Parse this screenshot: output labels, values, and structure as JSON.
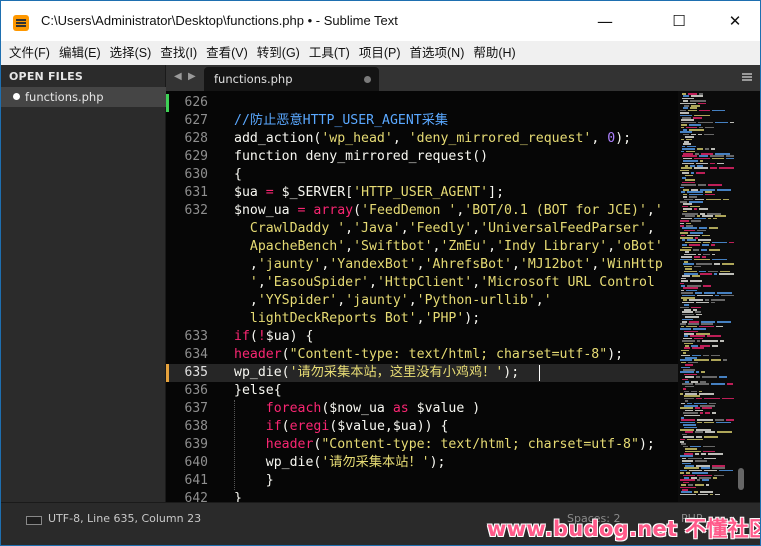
{
  "window": {
    "title": "C:\\Users\\Administrator\\Desktop\\functions.php • - Sublime Text",
    "minimize": "—",
    "maximize": "☐",
    "close": "✕"
  },
  "menu": [
    "文件(F)",
    "编辑(E)",
    "选择(S)",
    "查找(I)",
    "查看(V)",
    "转到(G)",
    "工具(T)",
    "项目(P)",
    "首选项(N)",
    "帮助(H)"
  ],
  "sidebar": {
    "header": "OPEN FILES",
    "files": [
      "functions.php"
    ]
  },
  "tabs": {
    "prev": "◀",
    "next": "▶",
    "active": "functions.php"
  },
  "gutter": [
    "626",
    "627",
    "628",
    "629",
    "630",
    "631",
    "632",
    "",
    "",
    "",
    "",
    "",
    "",
    "633",
    "634",
    "635",
    "636",
    "637",
    "638",
    "639",
    "640",
    "641",
    "642"
  ],
  "code": [
    [],
    [
      {
        "t": "//防止恶意HTTP_USER_AGENT采集",
        "c": "comment"
      }
    ],
    [
      {
        "t": "add_action",
        "c": "plain"
      },
      {
        "t": "(",
        "c": "plain"
      },
      {
        "t": "'wp_head'",
        "c": "str"
      },
      {
        "t": ", ",
        "c": "plain"
      },
      {
        "t": "'deny_mirrored_request'",
        "c": "str"
      },
      {
        "t": ", ",
        "c": "plain"
      },
      {
        "t": "0",
        "c": "num"
      },
      {
        "t": ");",
        "c": "plain"
      }
    ],
    [
      {
        "t": "function",
        "c": "plain"
      },
      {
        "t": " deny_mirrored_request()",
        "c": "plain"
      }
    ],
    [
      {
        "t": "{",
        "c": "plain"
      }
    ],
    [
      {
        "t": "$ua",
        "c": "plain"
      },
      {
        "t": " = ",
        "c": "op"
      },
      {
        "t": "$_SERVER",
        "c": "plain"
      },
      {
        "t": "[",
        "c": "plain"
      },
      {
        "t": "'HTTP_USER_AGENT'",
        "c": "str"
      },
      {
        "t": "];",
        "c": "plain"
      }
    ],
    [
      {
        "t": "$now_ua",
        "c": "plain"
      },
      {
        "t": " = ",
        "c": "op"
      },
      {
        "t": "array",
        "c": "kw"
      },
      {
        "t": "(",
        "c": "plain"
      },
      {
        "t": "'FeedDemon '",
        "c": "str"
      },
      {
        "t": ",",
        "c": "plain"
      },
      {
        "t": "'BOT/0.1 (BOT for JCE)'",
        "c": "str"
      },
      {
        "t": ",",
        "c": "plain"
      },
      {
        "t": "'",
        "c": "str"
      }
    ],
    [
      {
        "t": "  CrawlDaddy '",
        "c": "str"
      },
      {
        "t": ",",
        "c": "plain"
      },
      {
        "t": "'Java'",
        "c": "str"
      },
      {
        "t": ",",
        "c": "plain"
      },
      {
        "t": "'Feedly'",
        "c": "str"
      },
      {
        "t": ",",
        "c": "plain"
      },
      {
        "t": "'UniversalFeedParser'",
        "c": "str"
      },
      {
        "t": ",",
        "c": "plain"
      }
    ],
    [
      {
        "t": "  ApacheBench'",
        "c": "str"
      },
      {
        "t": ",",
        "c": "plain"
      },
      {
        "t": "'Swiftbot'",
        "c": "str"
      },
      {
        "t": ",",
        "c": "plain"
      },
      {
        "t": "'ZmEu'",
        "c": "str"
      },
      {
        "t": ",",
        "c": "plain"
      },
      {
        "t": "'Indy Library'",
        "c": "str"
      },
      {
        "t": ",",
        "c": "plain"
      },
      {
        "t": "'oBot'",
        "c": "str"
      }
    ],
    [
      {
        "t": "  ,",
        "c": "plain"
      },
      {
        "t": "'jaunty'",
        "c": "str"
      },
      {
        "t": ",",
        "c": "plain"
      },
      {
        "t": "'YandexBot'",
        "c": "str"
      },
      {
        "t": ",",
        "c": "plain"
      },
      {
        "t": "'AhrefsBot'",
        "c": "str"
      },
      {
        "t": ",",
        "c": "plain"
      },
      {
        "t": "'MJ12bot'",
        "c": "str"
      },
      {
        "t": ",",
        "c": "plain"
      },
      {
        "t": "'WinHttp",
        "c": "str"
      }
    ],
    [
      {
        "t": "  '",
        "c": "str"
      },
      {
        "t": ",",
        "c": "plain"
      },
      {
        "t": "'EasouSpider'",
        "c": "str"
      },
      {
        "t": ",",
        "c": "plain"
      },
      {
        "t": "'HttpClient'",
        "c": "str"
      },
      {
        "t": ",",
        "c": "plain"
      },
      {
        "t": "'Microsoft URL Control",
        "c": "str"
      }
    ],
    [
      {
        "t": "  ,",
        "c": "plain"
      },
      {
        "t": "'YYSpider'",
        "c": "str"
      },
      {
        "t": ",",
        "c": "plain"
      },
      {
        "t": "'jaunty'",
        "c": "str"
      },
      {
        "t": ",",
        "c": "plain"
      },
      {
        "t": "'Python-urllib'",
        "c": "str"
      },
      {
        "t": ",",
        "c": "plain"
      },
      {
        "t": "'",
        "c": "str"
      }
    ],
    [
      {
        "t": "  lightDeckReports Bot'",
        "c": "str"
      },
      {
        "t": ",",
        "c": "plain"
      },
      {
        "t": "'PHP'",
        "c": "str"
      },
      {
        "t": ");",
        "c": "plain"
      }
    ],
    [
      {
        "t": "if",
        "c": "kw"
      },
      {
        "t": "(",
        "c": "plain"
      },
      {
        "t": "!",
        "c": "op"
      },
      {
        "t": "$ua",
        "c": "plain"
      },
      {
        "t": ") {",
        "c": "plain"
      }
    ],
    [
      {
        "t": "header",
        "c": "kw"
      },
      {
        "t": "(",
        "c": "plain"
      },
      {
        "t": "\"Content-type: text/html; charset=utf-8\"",
        "c": "str"
      },
      {
        "t": ");",
        "c": "plain"
      }
    ],
    [
      {
        "t": "wp_die",
        "c": "plain"
      },
      {
        "t": "(",
        "c": "plain"
      },
      {
        "t": "'请勿采集本站，这里没有小鸡鸡！'",
        "c": "str"
      },
      {
        "t": ");",
        "c": "plain"
      }
    ],
    [
      {
        "t": "}else{",
        "c": "plain"
      }
    ],
    [
      {
        "t": "    ",
        "c": "plain"
      },
      {
        "t": "foreach",
        "c": "kw"
      },
      {
        "t": "(",
        "c": "plain"
      },
      {
        "t": "$now_ua",
        "c": "plain"
      },
      {
        "t": " as ",
        "c": "kw"
      },
      {
        "t": "$value",
        "c": "plain"
      },
      {
        "t": " )",
        "c": "plain"
      }
    ],
    [
      {
        "t": "    ",
        "c": "plain"
      },
      {
        "t": "if",
        "c": "kw"
      },
      {
        "t": "(",
        "c": "plain"
      },
      {
        "t": "eregi",
        "c": "kw"
      },
      {
        "t": "(",
        "c": "plain"
      },
      {
        "t": "$value",
        "c": "plain"
      },
      {
        "t": ",",
        "c": "plain"
      },
      {
        "t": "$ua",
        "c": "plain"
      },
      {
        "t": ")) {",
        "c": "plain"
      }
    ],
    [
      {
        "t": "    ",
        "c": "plain"
      },
      {
        "t": "header",
        "c": "kw"
      },
      {
        "t": "(",
        "c": "plain"
      },
      {
        "t": "\"Content-type: text/html; charset=utf-8\"",
        "c": "str"
      },
      {
        "t": ");",
        "c": "plain"
      }
    ],
    [
      {
        "t": "    ",
        "c": "plain"
      },
      {
        "t": "wp_die",
        "c": "plain"
      },
      {
        "t": "(",
        "c": "plain"
      },
      {
        "t": "'请勿采集本站！'",
        "c": "str"
      },
      {
        "t": ");",
        "c": "plain"
      }
    ],
    [
      {
        "t": "    }",
        "c": "plain"
      }
    ],
    [
      {
        "t": "}",
        "c": "plain"
      }
    ]
  ],
  "status": {
    "position": "UTF-8, Line 635, Column 23",
    "spaces": "Spaces: 2",
    "syntax": "PHP"
  },
  "watermark": "www.budog.net 不懂社区",
  "colors": {
    "comment": "#5aa8ff",
    "str": "#e6db74",
    "kw": "#f92672",
    "num": "#ae81ff",
    "op": "#f92672",
    "plain": "#f8f8f2",
    "modified": "#3ed156",
    "current_mod": "#e6a23c"
  }
}
